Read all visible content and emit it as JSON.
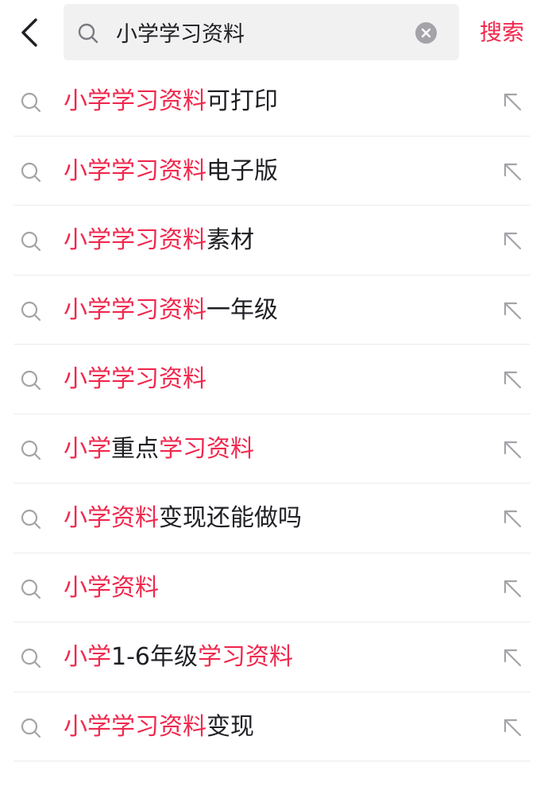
{
  "search": {
    "query": "小学学习资料",
    "button_label": "搜索",
    "icon": "search-icon",
    "clear_icon": "clear-icon"
  },
  "nav": {
    "back_icon": "back-arrow-icon"
  },
  "colors": {
    "accent": "#f0284d",
    "text": "#1f1f24",
    "icon": "#a3a3a8",
    "divider": "#ececee",
    "field_bg": "#f1f1f2"
  },
  "suggestions": [
    {
      "segments": [
        {
          "text": "小学学习资料",
          "hl": true
        },
        {
          "text": "可打印",
          "hl": false
        }
      ]
    },
    {
      "segments": [
        {
          "text": "小学学习资料",
          "hl": true
        },
        {
          "text": "电子版",
          "hl": false
        }
      ]
    },
    {
      "segments": [
        {
          "text": "小学学习资料",
          "hl": true
        },
        {
          "text": "素材",
          "hl": false
        }
      ]
    },
    {
      "segments": [
        {
          "text": "小学学习资料",
          "hl": true
        },
        {
          "text": "一年级",
          "hl": false
        }
      ]
    },
    {
      "segments": [
        {
          "text": "小学学习资料",
          "hl": true
        }
      ]
    },
    {
      "segments": [
        {
          "text": "小学",
          "hl": true
        },
        {
          "text": "重点",
          "hl": false
        },
        {
          "text": "学习资料",
          "hl": true
        }
      ]
    },
    {
      "segments": [
        {
          "text": "小学资料",
          "hl": true
        },
        {
          "text": "变现还能做吗",
          "hl": false
        }
      ]
    },
    {
      "segments": [
        {
          "text": "小学资料",
          "hl": true
        }
      ]
    },
    {
      "segments": [
        {
          "text": "小学",
          "hl": true
        },
        {
          "text": "1-6年级",
          "hl": false
        },
        {
          "text": "学习资料",
          "hl": true
        }
      ]
    },
    {
      "segments": [
        {
          "text": "小学学习资料",
          "hl": true
        },
        {
          "text": "变现",
          "hl": false
        }
      ]
    }
  ]
}
